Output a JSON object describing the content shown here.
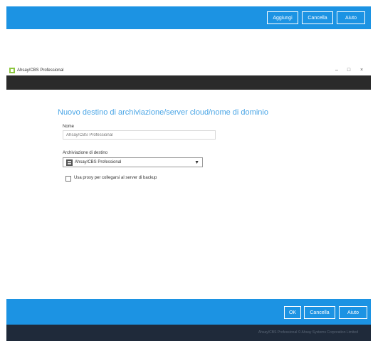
{
  "top_toolbar": {
    "buttons": [
      "Aggiungi",
      "Cancella",
      "Aiuto"
    ]
  },
  "window": {
    "title": "Ahsay/CBS Professional",
    "controls": {
      "minimize": "–",
      "maximize": "□",
      "close": "×"
    }
  },
  "form": {
    "heading": "Nuovo destino di archiviazione/server cloud/nome di dominio",
    "name_label": "Nome",
    "name_placeholder": "Ahsay/CBS Professional",
    "type_label": "Archiviazione di destino",
    "type_value": "Ahsay/CBS Professional",
    "checkbox_label": "Usa proxy per collegarsi al server di backup"
  },
  "bottom_toolbar": {
    "buttons": [
      "OK",
      "Cancella",
      "Aiuto"
    ]
  },
  "footer": {
    "text": "Ahsay/CBS Professional © Ahsay Systems Corporation Limited"
  },
  "colors": {
    "accent": "#1c93e3",
    "heading": "#4ba6e6",
    "dark_band": "#2a2a2a",
    "footer": "#1f2a3a"
  }
}
